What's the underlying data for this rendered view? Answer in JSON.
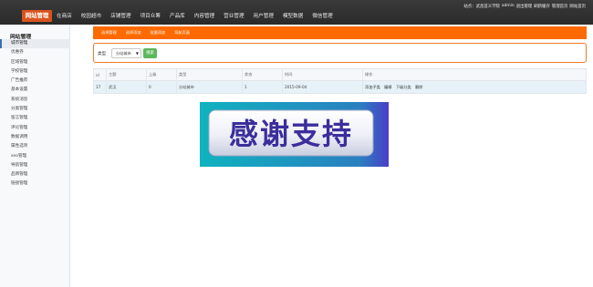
{
  "header": {
    "brand": "网站管理",
    "nav": [
      "在商店",
      "校园超市",
      "店铺管理",
      "项目众筹",
      "产品库",
      "内容管理",
      "营业管理",
      "用户管理",
      "模型数据",
      "微信管理"
    ],
    "top_right": [
      "站点：武昌首义学院",
      "admin",
      "退出管理",
      "刷新缓存",
      "管理首页",
      "网站首页"
    ]
  },
  "sidebar": {
    "title": "网站管理",
    "items": [
      "城市管理",
      "优惠券",
      "区域管理",
      "学校管理",
      "广告推荐",
      "基本设置",
      "系统消息",
      "分类管理",
      "留言管理",
      "评论管理",
      "数据调用",
      "属性选项",
      "seo管理",
      "导航管理",
      "品牌管理",
      "链接管理"
    ]
  },
  "subtabs": [
    "选择管理",
    "选择添加",
    "批量添加",
    "导航页面"
  ],
  "filter": {
    "label": "类型",
    "selected": "分站城市",
    "button": "搜索"
  },
  "table": {
    "headers": [
      "id",
      "主题",
      "上级",
      "类型",
      "状态",
      "时间",
      "操作"
    ],
    "rows": [
      {
        "cells": [
          "17",
          "武汉",
          "0",
          "分站城市",
          "1",
          "2015-09-04"
        ],
        "actions": [
          "添加子类",
          "编辑",
          "下级分类",
          "删除"
        ]
      }
    ]
  },
  "banner": {
    "text": "感谢支持",
    "colors": {
      "frame": "#14a8b8",
      "panel": "#eef0f6",
      "text": "#3b2e9c",
      "frame_right": "#4a3fc8"
    }
  }
}
